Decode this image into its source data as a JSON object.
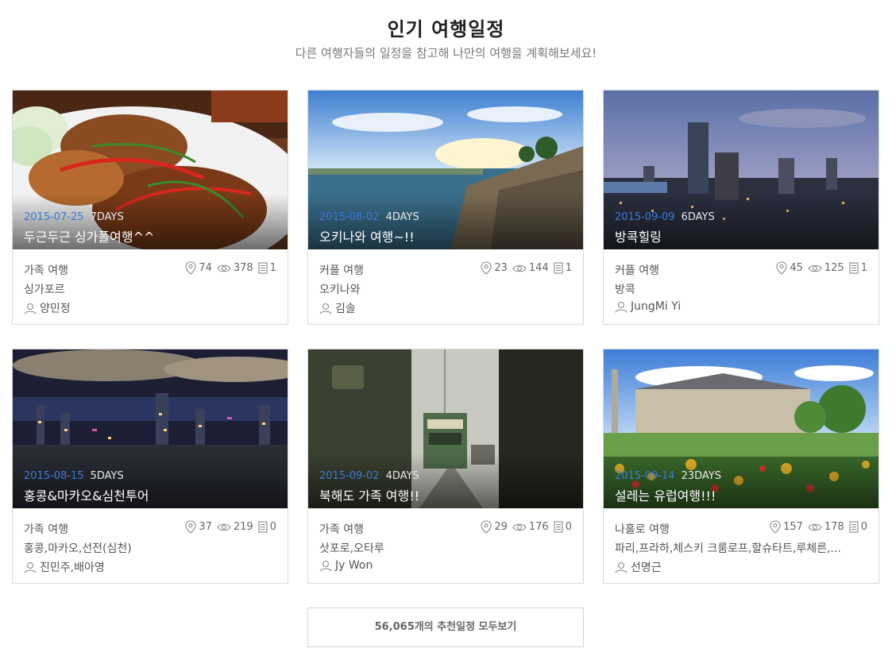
{
  "section": {
    "title": "인기 여행일정",
    "subtitle": "다른 여행자들의 일정을 참고해 나만의 여행을 계획해보세요!"
  },
  "trips": [
    {
      "date": "2015-07-25",
      "days": "7DAYS",
      "title": "두근두근 싱가폴여행^^",
      "category": "가족 여행",
      "places": "74",
      "views": "378",
      "notes": "1",
      "location": "싱가포르",
      "author": "양민정",
      "image": "grilled-fish-dish-photo"
    },
    {
      "date": "2015-08-02",
      "days": "4DAYS",
      "title": "오키나와 여행~!!",
      "category": "커플 여행",
      "places": "23",
      "views": "144",
      "notes": "1",
      "location": "오키나와",
      "author": "김솔",
      "image": "okinawa-seaside-photo"
    },
    {
      "date": "2015-09-09",
      "days": "6DAYS",
      "title": "방콕힐링",
      "category": "커플 여행",
      "places": "45",
      "views": "125",
      "notes": "1",
      "location": "방콕",
      "author": "JungMi Yi",
      "image": "bangkok-skyline-photo"
    },
    {
      "date": "2015-08-15",
      "days": "5DAYS",
      "title": "홍콩&마카오&심천투어",
      "category": "가족 여행",
      "places": "37",
      "views": "219",
      "notes": "0",
      "location": "홍콩,마카오,선전(심천)",
      "author": "진민주,배아영",
      "image": "hongkong-night-photo"
    },
    {
      "date": "2015-09-02",
      "days": "4DAYS",
      "title": "북해도 가족 여행!!",
      "category": "가족 여행",
      "places": "29",
      "views": "176",
      "notes": "0",
      "location": "삿포로,오타루",
      "author": "Jy Won",
      "image": "sapporo-tram-photo"
    },
    {
      "date": "2015-09-14",
      "days": "23DAYS",
      "title": "설레는 유럽여행!!!",
      "category": "나홀로 여행",
      "places": "157",
      "views": "178",
      "notes": "0",
      "location": "파리,프라하,체스키 크룸로프,할슈타트,루체른,...",
      "author": "선명근",
      "image": "paris-garden-photo"
    }
  ],
  "more_button": "56,065개의 추천일정 모두보기",
  "colors": {
    "date_accent": "#3a7ad9",
    "border": "#d9d9d9"
  }
}
